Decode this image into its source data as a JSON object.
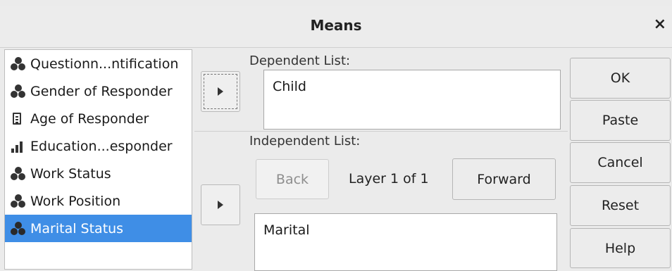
{
  "window": {
    "title": "Means",
    "close_glyph": "×"
  },
  "variables": [
    {
      "label": "Questionn...ntification",
      "icon": "nominal-icon",
      "selected": false
    },
    {
      "label": "Gender of Responder",
      "icon": "nominal-icon",
      "selected": false
    },
    {
      "label": "Age of Responder",
      "icon": "scale-icon",
      "selected": false
    },
    {
      "label": "Education...esponder",
      "icon": "ordinal-icon",
      "selected": false
    },
    {
      "label": "Work Status",
      "icon": "nominal-icon",
      "selected": false
    },
    {
      "label": "Work Position",
      "icon": "nominal-icon",
      "selected": false
    },
    {
      "label": "Marital Status",
      "icon": "nominal-icon",
      "selected": true
    }
  ],
  "dependent": {
    "label": "Dependent List:",
    "items": [
      "Child"
    ]
  },
  "independent": {
    "label": "Independent List:",
    "back_label": "Back",
    "layer_text": "Layer 1 of 1",
    "forward_label": "Forward",
    "items": [
      "Marital"
    ]
  },
  "buttons": {
    "ok": "OK",
    "paste": "Paste",
    "cancel": "Cancel",
    "reset": "Reset",
    "help": "Help"
  },
  "colors": {
    "selection": "#3f8ee6",
    "background": "#ebebeb"
  }
}
